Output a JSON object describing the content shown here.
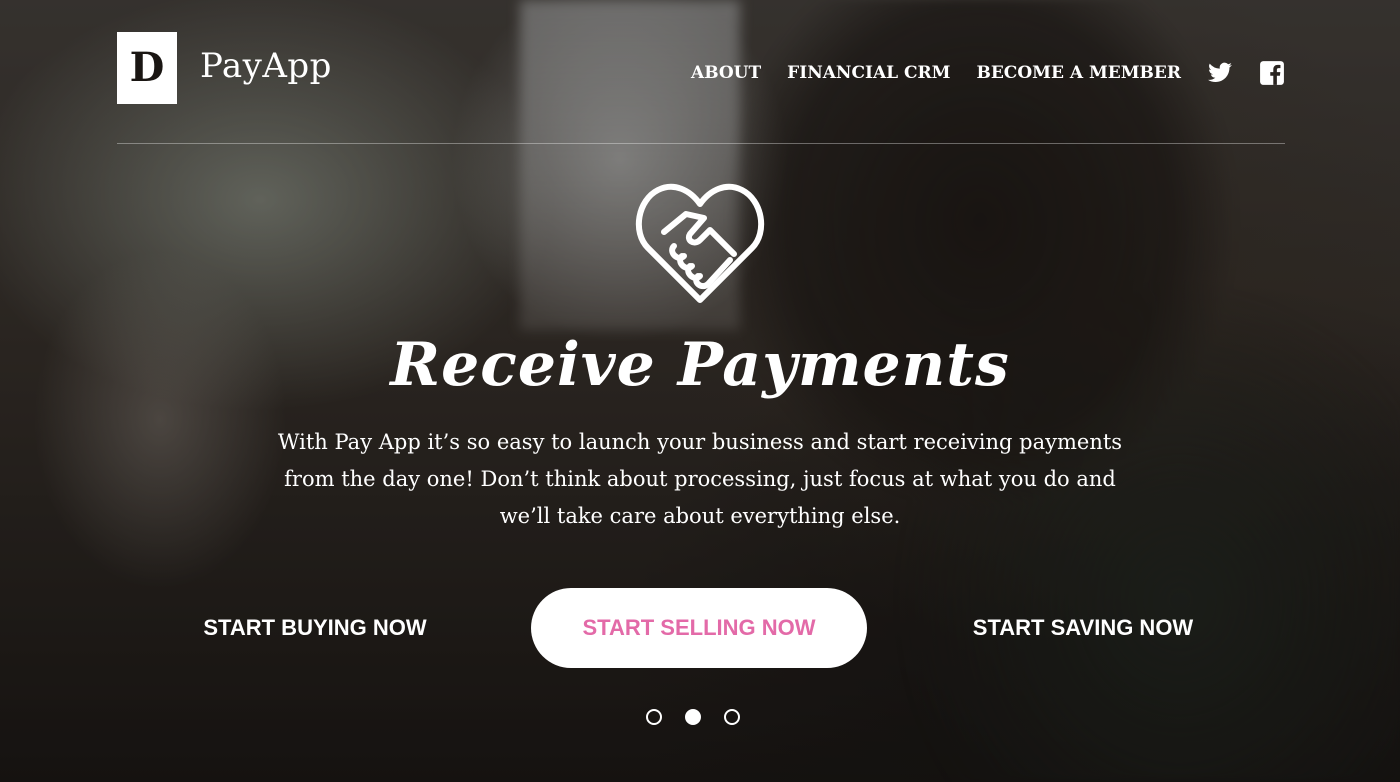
{
  "brand": {
    "logo_mark": "D",
    "name": "PayApp"
  },
  "nav": {
    "items": [
      {
        "label": "ABOUT"
      },
      {
        "label": "FINANCIAL CRM"
      },
      {
        "label": "BECOME A MEMBER"
      }
    ],
    "social": [
      {
        "icon": "twitter-icon"
      },
      {
        "icon": "facebook-icon"
      }
    ]
  },
  "hero": {
    "icon": "handshake-heart-icon",
    "title": "Receive Payments",
    "description": "With Pay App it’s so easy to launch your business and start receiving payments from the day one! Don’t think about processing, just focus at what you do and we’ll take care about everything else."
  },
  "cta": {
    "buy_label": "START BUYING NOW",
    "sell_label": "START SELLING NOW",
    "save_label": "START SAVING NOW"
  },
  "carousel": {
    "slide_count": 3,
    "active_index": 1
  },
  "colors": {
    "accent": "#e36aa8",
    "text": "#ffffff"
  }
}
